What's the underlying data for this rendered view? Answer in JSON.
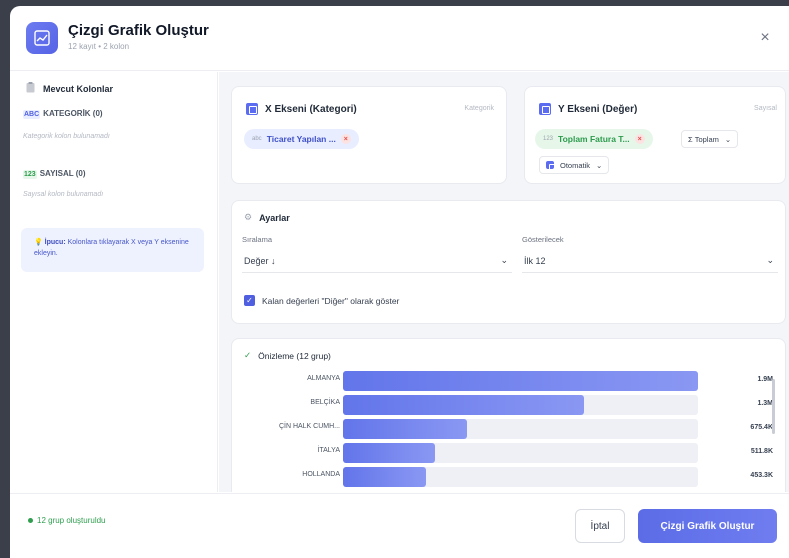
{
  "header": {
    "title": "Çizgi Grafik Oluştur",
    "subtitle": "12 kayıt • 2 kolon",
    "close_label": "×"
  },
  "sidebar": {
    "title": "Mevcut Kolonlar",
    "categorical": {
      "badge": "ABC",
      "label": "KATEGORİK (0)",
      "empty": "Kategorik kolon bulunamadı"
    },
    "numeric": {
      "badge": "123",
      "label": "SAYISAL (0)",
      "empty": "Sayısal kolon bulunamadı"
    },
    "tip": {
      "bold": "İpucu:",
      "text": " Kolonlara tıklayarak X veya Y eksenine ekleyin."
    }
  },
  "x_axis": {
    "title": "X Ekseni (Kategori)",
    "tag": "Kategorik",
    "chip_prefix": "abc",
    "chip_label": "Ticaret Yapılan ..."
  },
  "y_axis": {
    "title": "Y Ekseni (Değer)",
    "tag": "Sayısal",
    "chip_prefix": "123",
    "chip_label": "Toplam Fatura T...",
    "aggregate": "Σ Toplam",
    "scale": "Otomatik"
  },
  "settings": {
    "title": "Ayarlar",
    "sort_label": "Sıralama",
    "sort_value": "Değer ↓",
    "show_label": "Gösterilecek",
    "show_value": "İlk 12",
    "others_label": "Kalan değerleri \"Diğer\" olarak göster",
    "others_checked": true
  },
  "preview": {
    "title": "Önizleme (12 grup)",
    "rows": [
      {
        "label": "ALMANYA",
        "value": "1.9M",
        "fraction": 1.0
      },
      {
        "label": "BELÇİKA",
        "value": "1.3M",
        "fraction": 0.68
      },
      {
        "label": "ÇİN HALK CUMH...",
        "value": "675.4K",
        "fraction": 0.35
      },
      {
        "label": "İTALYA",
        "value": "511.8K",
        "fraction": 0.26
      },
      {
        "label": "HOLLANDA",
        "value": "453.3K",
        "fraction": 0.235
      }
    ]
  },
  "footer": {
    "status": "12 grup oluşturuldu",
    "cancel_label": "İptal",
    "submit_label": "Çizgi Grafik Oluştur"
  },
  "colors": {
    "accent": "#5b6ce6",
    "success": "#2f9e4f",
    "danger": "#e14b4b"
  }
}
